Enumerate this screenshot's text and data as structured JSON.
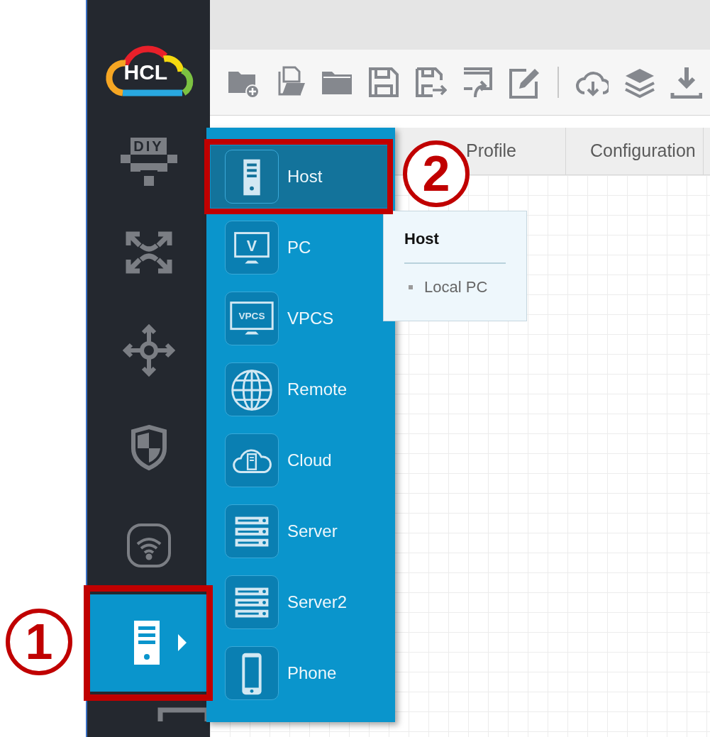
{
  "logo": {
    "text": "HCL"
  },
  "sidebar": {
    "items": [
      {
        "kind": "diy",
        "text": "DIY",
        "selected": false
      },
      {
        "kind": "arrows",
        "selected": false
      },
      {
        "kind": "move",
        "selected": false
      },
      {
        "kind": "shield",
        "selected": false
      },
      {
        "kind": "wifi",
        "selected": false
      },
      {
        "kind": "host",
        "selected": true
      },
      {
        "kind": "monitor",
        "selected": false
      }
    ]
  },
  "toolbar": {
    "items": [
      {
        "kind": "new-folder"
      },
      {
        "kind": "open-files"
      },
      {
        "kind": "folder"
      },
      {
        "kind": "save"
      },
      {
        "kind": "export"
      },
      {
        "kind": "import"
      },
      {
        "kind": "edit"
      },
      {
        "kind": "separator"
      },
      {
        "kind": "cloud-download"
      },
      {
        "kind": "layers"
      },
      {
        "kind": "download"
      }
    ]
  },
  "tabs": [
    {
      "label": "Profile",
      "selected": false
    },
    {
      "label": "Configuration",
      "selected": false
    }
  ],
  "device_menu": {
    "items": [
      {
        "kind": "host",
        "label": "Host",
        "selected": true
      },
      {
        "kind": "pc",
        "label": "PC",
        "icon_text": "V",
        "selected": false
      },
      {
        "kind": "vpcs",
        "label": "VPCS",
        "icon_text": "VPCS",
        "selected": false
      },
      {
        "kind": "globe",
        "label": "Remote",
        "selected": false
      },
      {
        "kind": "cloud",
        "label": "Cloud",
        "selected": false
      },
      {
        "kind": "server",
        "label": "Server",
        "selected": false
      },
      {
        "kind": "server",
        "label": "Server2",
        "selected": false
      },
      {
        "kind": "phone",
        "label": "Phone",
        "selected": false
      }
    ]
  },
  "tooltip": {
    "title": "Host",
    "items": [
      "Local PC"
    ]
  },
  "annotations": [
    {
      "label": "1"
    },
    {
      "label": "2"
    }
  ]
}
